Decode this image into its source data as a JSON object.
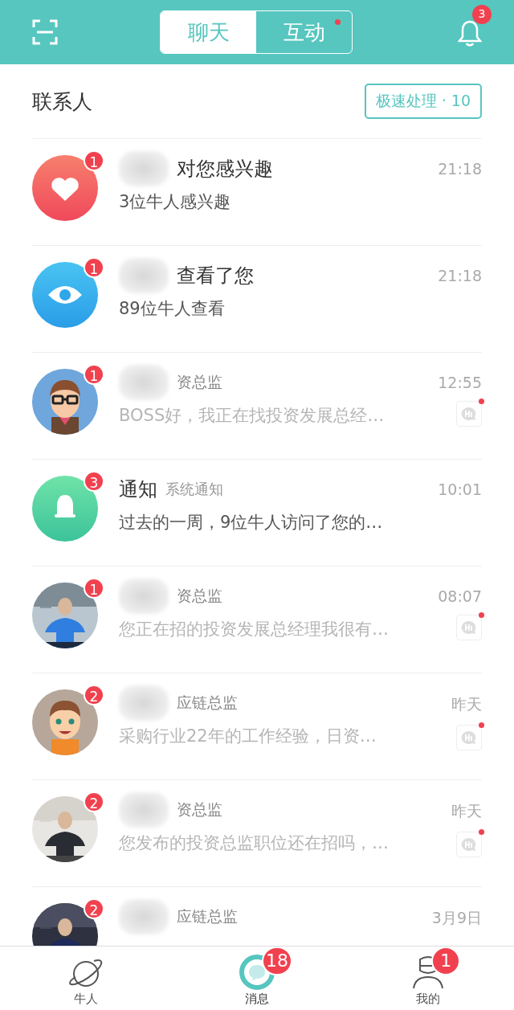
{
  "header": {
    "tabs": [
      {
        "label": "聊天",
        "selected": true,
        "dot": false
      },
      {
        "label": "互动",
        "selected": false,
        "dot": true
      }
    ],
    "bell_badge": "3"
  },
  "contacts": {
    "title": "联系人",
    "quick_button": "极速处理 · 10"
  },
  "rows": [
    {
      "kind": "system",
      "badge": "1",
      "blurred": true,
      "name": "对您感兴趣",
      "time": "21:18",
      "preview": "3位牛人感兴趣",
      "hi": false
    },
    {
      "kind": "system",
      "badge": "1",
      "blurred": true,
      "name": "查看了您",
      "time": "21:18",
      "preview": "89位牛人查看",
      "hi": false
    },
    {
      "kind": "greeting",
      "badge": "1",
      "blurred": true,
      "name": "资总监",
      "time": "12:55",
      "preview": "BOSS好，我正在找投资发展总经…",
      "hi": true
    },
    {
      "kind": "system",
      "badge": "3",
      "blurred": false,
      "name": "通知",
      "tag": "系统通知",
      "time": "10:01",
      "preview": "过去的一周，9位牛人访问了您的…",
      "hi": false
    },
    {
      "kind": "greeting",
      "badge": "1",
      "blurred": true,
      "name": "资总监",
      "time": "08:07",
      "preview": "您正在招的投资发展总经理我很有…",
      "hi": true
    },
    {
      "kind": "greeting",
      "badge": "2",
      "blurred": true,
      "name": "应链总监",
      "time": "昨天",
      "preview": "采购行业22年的工作经验，日资…",
      "hi": true
    },
    {
      "kind": "greeting",
      "badge": "2",
      "blurred": true,
      "name": "资总监",
      "time": "昨天",
      "preview": "您发布的投资总监职位还在招吗，…",
      "hi": true
    },
    {
      "kind": "greeting",
      "badge": "2",
      "blurred": true,
      "name": "应链总监",
      "time": "3月9日",
      "hi": false
    }
  ],
  "tabbar": [
    {
      "label": "牛人",
      "selected": false
    },
    {
      "label": "消息",
      "selected": true,
      "badge": "18"
    },
    {
      "label": "我的",
      "selected": false,
      "badge": "1"
    }
  ]
}
